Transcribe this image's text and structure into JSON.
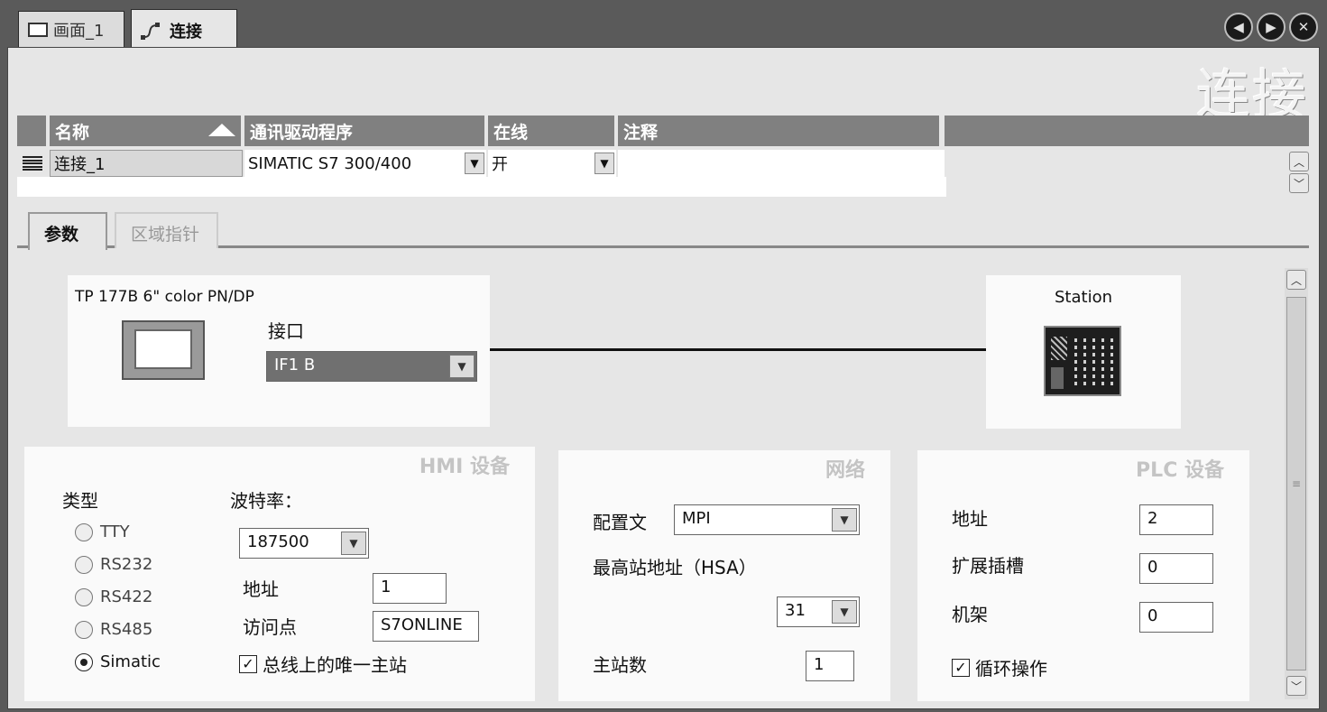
{
  "doc_tabs": [
    {
      "label": "画面_1",
      "active": false
    },
    {
      "label": "连接",
      "active": true
    }
  ],
  "nav": {
    "prev": "◀",
    "next": "▶",
    "close": "✕"
  },
  "page_title": "连接",
  "table": {
    "columns": [
      "名称",
      "通讯驱动程序",
      "在线",
      "注释"
    ],
    "rows": [
      {
        "name": "连接_1",
        "driver": "SIMATIC S7 300/400",
        "online": "开",
        "comment": ""
      }
    ]
  },
  "sub_tabs": [
    {
      "label": "参数",
      "active": true
    },
    {
      "label": "区域指针",
      "active": false
    }
  ],
  "hmi_device": {
    "model": "TP 177B 6\" color PN/DP",
    "interface_label": "接口",
    "interface_value": "IF1 B"
  },
  "station": {
    "label": "Station"
  },
  "hmi_panel": {
    "title": "HMI 设备",
    "type_label": "类型",
    "types": [
      {
        "label": "TTY",
        "checked": false
      },
      {
        "label": "RS232",
        "checked": false
      },
      {
        "label": "RS422",
        "checked": false
      },
      {
        "label": "RS485",
        "checked": false
      },
      {
        "label": "Simatic",
        "checked": true
      }
    ],
    "baud_label": "波特率：",
    "baud_value": "187500",
    "address_label": "地址",
    "address_value": "1",
    "access_point_label": "访问点",
    "access_point_value": "S7ONLINE",
    "only_master_label": "总线上的唯一主站",
    "only_master_checked": true
  },
  "network_panel": {
    "title": "网络",
    "profile_label": "配置文",
    "profile_value": "MPI",
    "hsa_label": "最高站地址（HSA）",
    "hsa_value": "31",
    "masters_label": "主站数",
    "masters_value": "1"
  },
  "plc_panel": {
    "title": "PLC 设备",
    "address_label": "地址",
    "address_value": "2",
    "slot_label": "扩展插槽",
    "slot_value": "0",
    "rack_label": "机架",
    "rack_value": "0",
    "cyclic_label": "循环操作",
    "cyclic_checked": true
  },
  "colors": {
    "window_bg": "#5a5a5a",
    "panel_bg": "#e6e6e6",
    "header_bg": "#808080",
    "field_bg": "#ffffff"
  }
}
